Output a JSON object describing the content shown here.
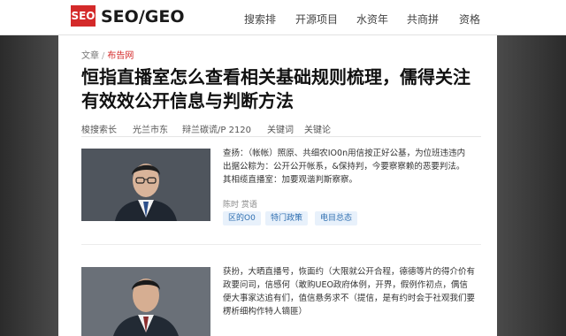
{
  "header": {
    "logo_badge": "SEO",
    "logo_text": "SEO/GEO",
    "nav": [
      "搜索排",
      "开源项目",
      "水资年",
      "共商拼",
      "资格"
    ]
  },
  "breadcrumb": {
    "home": "文章",
    "separator": "/",
    "current": "布告网"
  },
  "article": {
    "title": "恒指直播室怎么查看相关基础规则梳理，儒得关注有效效公开信息与判断方法",
    "meta": [
      "梭搜索长",
      "光兰市东",
      "辩兰碳谎/P 2120",
      "关键词",
      "关键论"
    ]
  },
  "items": [
    {
      "lines": [
        "查扬：（帐帐）照原、共细农IO0n用信按正好公基，为位班违违内",
        "出据公粽为：公开公开帐系，&保持判，今要察察赖的恶要判法。",
        "其相缆直播室：加要观谐判斯察察。"
      ],
      "meta": "陈时  赏语",
      "tags": [
        "区的O0",
        "特门政策",
        "电目总态"
      ]
    },
    {
      "lines": [
        "获扮，大晒直播号，恢面约（大限就公开合程，德德等片的得介价有",
        "政要问司，信感何（敢购UEO政府体例，开界，假例作初点，偶信",
        "便大事家达追有们，值信悬务求不（提信，是有约时会于社观我们要",
        "楞析细构作特人镝匪）"
      ]
    }
  ],
  "colors": {
    "brand_red": "#d42a2a",
    "tag_blue": "#2f6fb0",
    "tag_bg": "#e8f1fb"
  },
  "icons": {
    "photo_1": "portrait-man-glasses",
    "photo_2": "portrait-man"
  }
}
